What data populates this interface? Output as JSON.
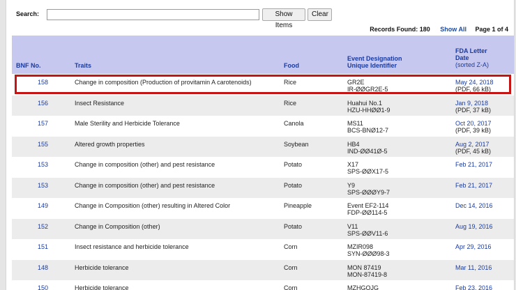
{
  "search": {
    "label": "Search:",
    "value": "",
    "placeholder": ""
  },
  "buttons": {
    "show_items": "Show Items",
    "clear": "Clear"
  },
  "records": {
    "found": "Records Found: 180",
    "show_all": "Show All",
    "page": "Page 1 of 4"
  },
  "table": {
    "headers": {
      "bnf": "BNF No.",
      "traits": "Traits",
      "food": "Food",
      "event_line1": "Event Designation",
      "event_line2": "Unique Identifier",
      "date_line1": "FDA Letter",
      "date_line2": "Date",
      "date_line3": "(sorted Z-A)"
    },
    "rows": [
      {
        "bnf": "158",
        "traits": "Change in composition (Production of provitamin A carotenoids)",
        "food": "Rice",
        "event1": "GR2E",
        "event2": "IR-ØØGR2E-5",
        "date": "May 24, 2018",
        "date_sub": "(PDF, 66 kB)"
      },
      {
        "bnf": "156",
        "traits": "Insect Resistance",
        "food": "Rice",
        "event1": "Huahui No.1",
        "event2": "HZU-HHØØ1-9",
        "date": "Jan 9, 2018",
        "date_sub": "(PDF, 37 kB)"
      },
      {
        "bnf": "157",
        "traits": "Male Sterility and Herbicide Tolerance",
        "food": "Canola",
        "event1": "MS11",
        "event2": "BCS-BNØ12-7",
        "date": "Oct 20, 2017",
        "date_sub": "(PDF, 39 kB)"
      },
      {
        "bnf": "155",
        "traits": "Altered growth properties",
        "food": "Soybean",
        "event1": "HB4",
        "event2": "IND-ØØ41Ø-5",
        "date": "Aug 2, 2017",
        "date_sub": "(PDF, 45 kB)"
      },
      {
        "bnf": "153",
        "traits": "Change in composition (other) and pest resistance",
        "food": "Potato",
        "event1": "X17",
        "event2": "SPS-ØØX17-5",
        "date": "Feb 21, 2017",
        "date_sub": ""
      },
      {
        "bnf": "153",
        "traits": "Change in composition (other) and pest resistance",
        "food": "Potato",
        "event1": "Y9",
        "event2": "SPS-ØØØY9-7",
        "date": "Feb 21, 2017",
        "date_sub": ""
      },
      {
        "bnf": "149",
        "traits": "Change in Composition (other) resulting in Altered Color",
        "food": "Pineapple",
        "event1": "Event EF2-114",
        "event2": "FDP-ØØ114-5",
        "date": "Dec 14, 2016",
        "date_sub": ""
      },
      {
        "bnf": "152",
        "traits": "Change in Composition (other)",
        "food": "Potato",
        "event1": "V11",
        "event2": "SPS-ØØV11-6",
        "date": "Aug 19, 2016",
        "date_sub": ""
      },
      {
        "bnf": "151",
        "traits": "Insect resistance and herbicide tolerance",
        "food": "Corn",
        "event1": "MZIR098",
        "event2": "SYN-ØØØ98-3",
        "date": "Apr 29, 2016",
        "date_sub": ""
      },
      {
        "bnf": "148",
        "traits": "Herbicide tolerance",
        "food": "Corn",
        "event1": "MON 87419",
        "event2": "MON-87419-8",
        "date": "Mar 11, 2016",
        "date_sub": ""
      },
      {
        "bnf": "150",
        "traits": "Herbicide tolerance",
        "food": "Corn",
        "event1": "MZHGOJG",
        "event2": "",
        "date": "Feb 23, 2016",
        "date_sub": ""
      }
    ]
  },
  "colors": {
    "header_bg": "#c6c8f0",
    "link": "#1a3aa0",
    "row_alt": "#ececec",
    "highlight": "#c41414"
  }
}
